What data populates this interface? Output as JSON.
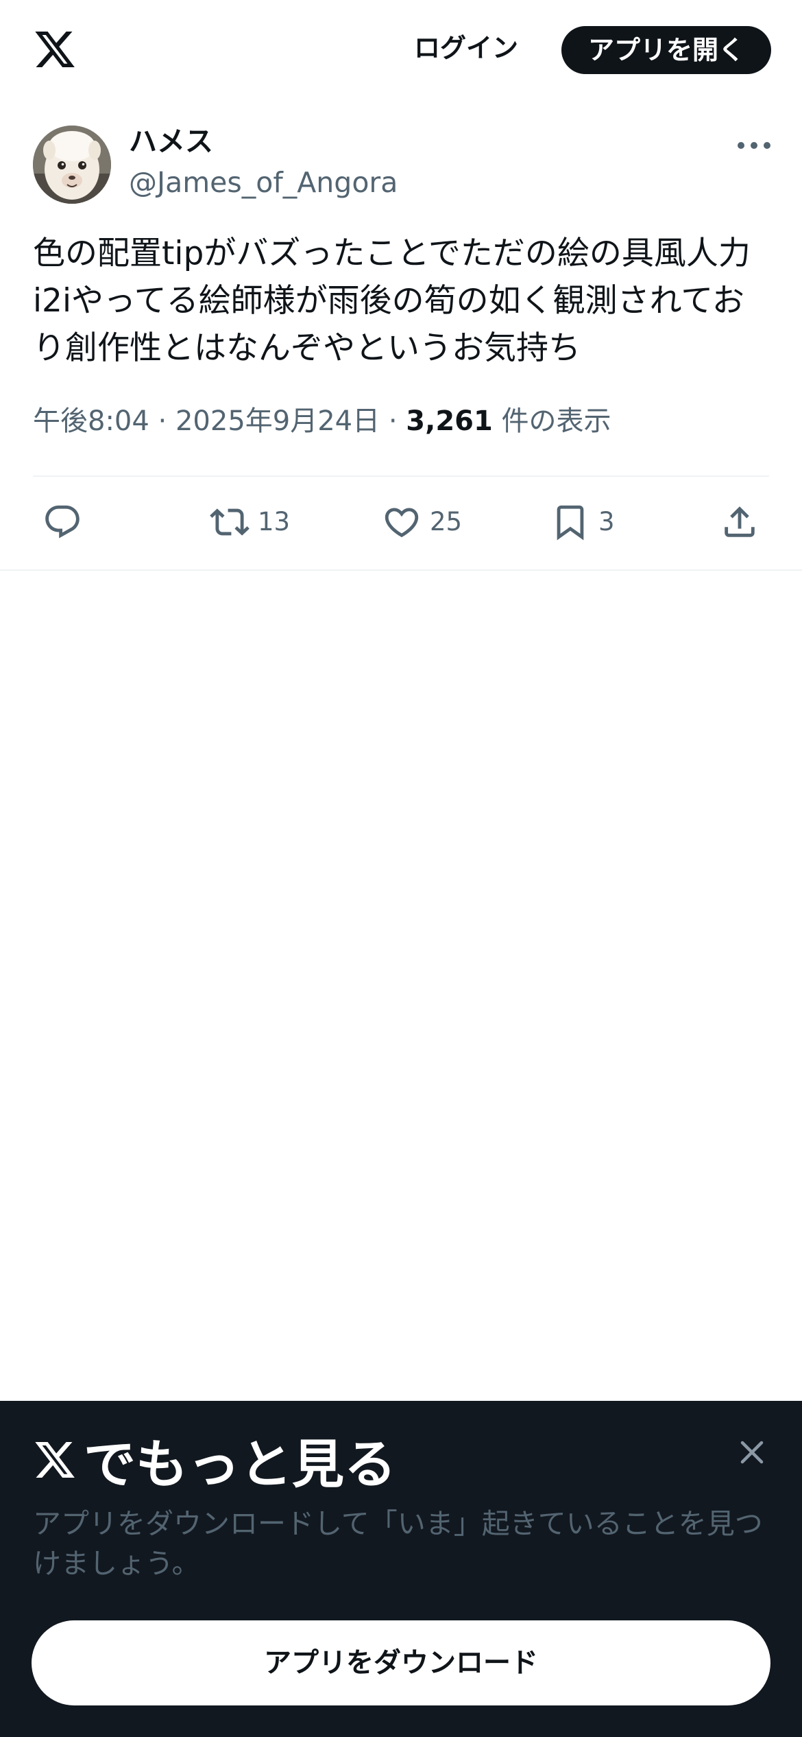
{
  "header": {
    "logo_icon": "x-logo-icon",
    "login_label": "ログイン",
    "open_app_label": "アプリを開く"
  },
  "tweet": {
    "author": {
      "display_name": "ハメス",
      "handle": "@James_of_Angora",
      "avatar": "alpaca-avatar"
    },
    "text": "色の配置tipがバズったことでただの絵の具風人力\ni2iやってる絵師様が雨後の筍の如く観測されてお\nり創作性とはなんぞやというお気持ち",
    "time": "午後8:04",
    "separator": "·",
    "date": "2025年9月24日",
    "views_count": "3,261",
    "views_label": "件の表示",
    "actions": {
      "reply": {
        "icon": "reply-icon"
      },
      "retweet": {
        "icon": "retweet-icon",
        "count": "13"
      },
      "like": {
        "icon": "heart-icon",
        "count": "25"
      },
      "bookmark": {
        "icon": "bookmark-icon",
        "count": "3"
      },
      "share": {
        "icon": "share-icon"
      }
    }
  },
  "promo": {
    "title": "でもっと見る",
    "description": "アプリをダウンロードして「いま」起きていることを見つけましょう。",
    "download_label": "アプリをダウンロード",
    "close_icon": "close-icon"
  },
  "colors": {
    "text_primary": "#0f1419",
    "text_secondary": "#536471",
    "promo_background": "#121820",
    "divider": "#eff3f4"
  }
}
